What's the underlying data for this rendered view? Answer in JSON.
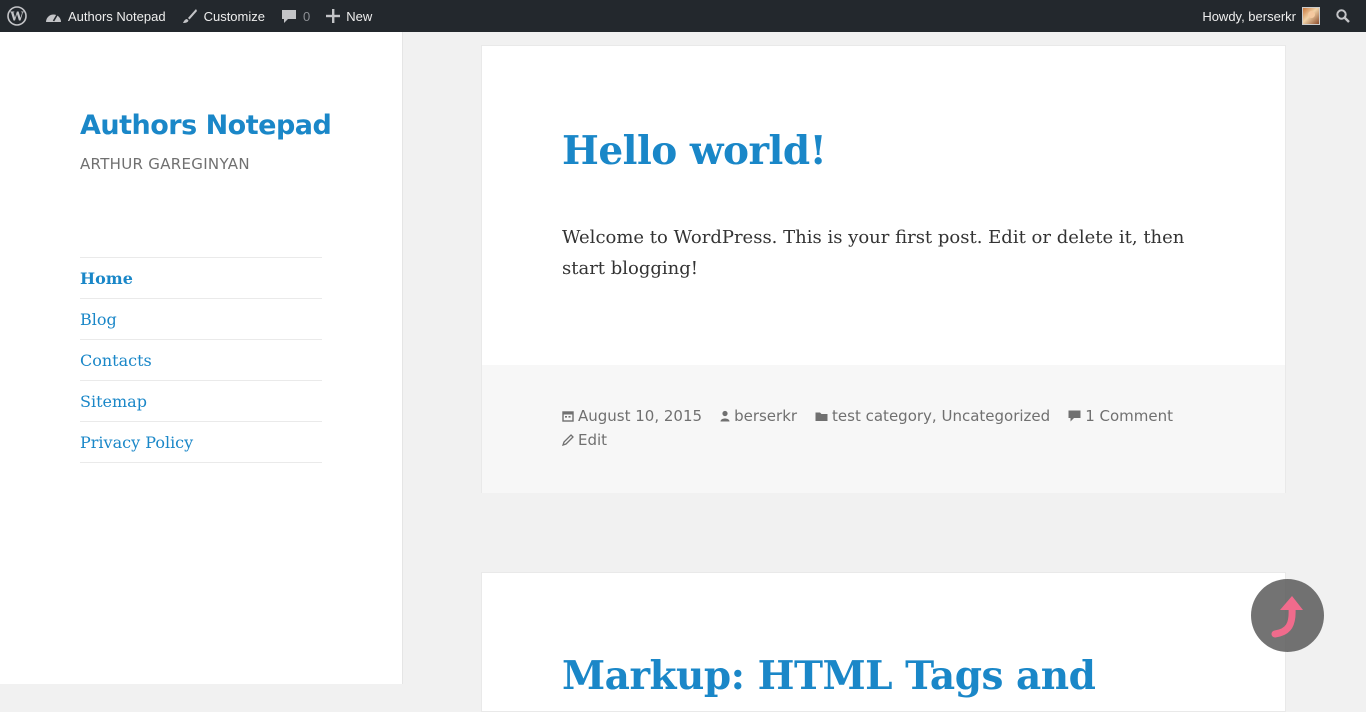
{
  "adminbar": {
    "wp_icon": "wordpress-logo-icon",
    "site_name": "Authors Notepad",
    "site_icon": "dashboard-icon",
    "customize": "Customize",
    "customize_icon": "brush-icon",
    "comments_count": "0",
    "comments_icon": "comment-bubble-icon",
    "new_label": "New",
    "new_icon": "plus-icon",
    "howdy": "Howdy, berserkr",
    "search_icon": "search-icon"
  },
  "site": {
    "title": "Authors Notepad",
    "description": "ARTHUR GAREGINYAN"
  },
  "menu": {
    "items": [
      {
        "label": "Home",
        "current": true
      },
      {
        "label": "Blog"
      },
      {
        "label": "Contacts"
      },
      {
        "label": "Sitemap"
      },
      {
        "label": "Privacy Policy"
      }
    ]
  },
  "posts": [
    {
      "title": "Hello world!",
      "content": "Welcome to WordPress. This is your first post. Edit or delete it, then start blogging!",
      "date": "August 10, 2015",
      "author": "berserkr",
      "categories": [
        "test category",
        "Uncategorized"
      ],
      "category_separator": ",",
      "comments": "1 Comment",
      "edit": "Edit"
    },
    {
      "title": "Markup: HTML Tags and"
    }
  ],
  "colors": {
    "link": "#1a87c8",
    "adminbar_bg": "#23282d",
    "scroll_arrow": "#f06b8c"
  },
  "scroll_top_icon": "curved-up-arrow-icon"
}
